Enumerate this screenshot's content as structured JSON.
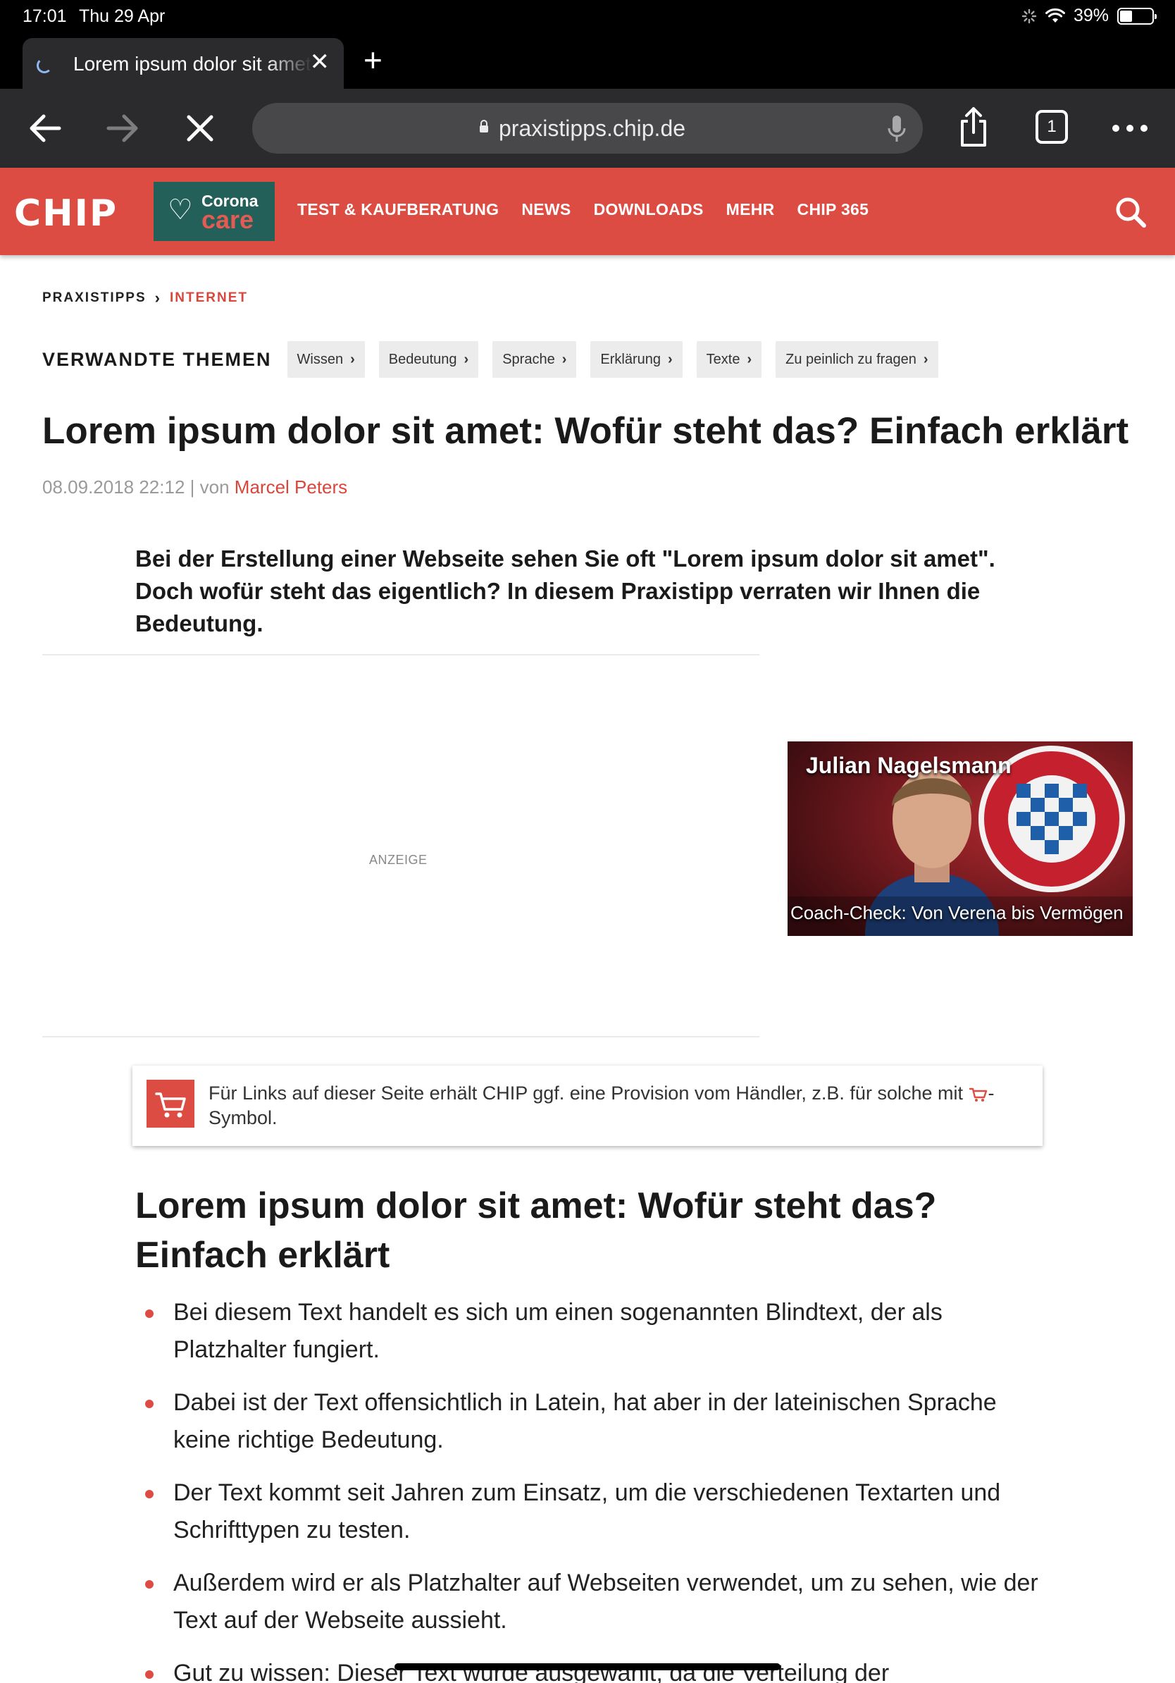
{
  "status_bar": {
    "time": "17:01",
    "date": "Thu 29 Apr",
    "battery": "39%",
    "battery_level": 0.39
  },
  "browser": {
    "tab_title": "Lorem ipsum dolor sit amet: Wofür steht das? Einfach erklärt",
    "url": "praxistipps.chip.de",
    "tab_count": "1"
  },
  "site_header": {
    "logo": "CHIP",
    "corona_top": "Corona",
    "corona_bottom": "care",
    "nav": [
      "TEST & KAUFBERATUNG",
      "NEWS",
      "DOWNLOADS",
      "MEHR",
      "CHIP 365"
    ]
  },
  "breadcrumb": {
    "home": "PRAXISTIPPS",
    "current": "INTERNET"
  },
  "related": {
    "label": "VERWANDTE THEMEN",
    "tags": [
      "Wissen",
      "Bedeutung",
      "Sprache",
      "Erklärung",
      "Texte",
      "Zu peinlich zu fragen"
    ]
  },
  "article": {
    "title": "Lorem ipsum dolor sit amet: Wofür steht das? Einfach erklärt",
    "date": "08.09.2018 22:12",
    "separator": "| von",
    "author": "Marcel Peters",
    "lead": "Bei der Erstellung einer Webseite sehen Sie oft \"Lorem ipsum dolor sit amet\". Doch wofür steht das eigentlich? In diesem Praxistipp verraten wir Ihnen die Bedeutung.",
    "ad_label": "ANZEIGE",
    "video": {
      "title": "Julian Nagelsmann",
      "caption": "Coach-Check: Von Verena bis Vermögen"
    },
    "provision_text_a": "Für Links auf dieser Seite erhält CHIP ggf. eine Provision vom Händler, z.B. für solche mit",
    "provision_text_b": "-Symbol.",
    "section_title": "Lorem ipsum dolor sit amet: Wofür steht das? Einfach erklärt",
    "bullets": [
      "Bei diesem Text handelt es sich um einen sogenannten Blindtext, der als Platzhalter fungiert.",
      "Dabei ist der Text offensichtlich in Latein, hat aber in der lateinischen Sprache keine richtige Bedeutung.",
      "Der Text kommt seit Jahren zum Einsatz, um die verschiedenen Textarten und Schrifttypen zu testen.",
      "Außerdem wird er als Platzhalter auf Webseiten verwendet, um zu sehen, wie der Text auf der Webseite aussieht.",
      "Gut zu wissen: Dieser Text wurde ausgewählt, da die Verteilung der"
    ]
  },
  "colors": {
    "brand_red": "#dd4c43",
    "corona_green": "#24605a",
    "browser_dark": "#2b2b2d"
  }
}
